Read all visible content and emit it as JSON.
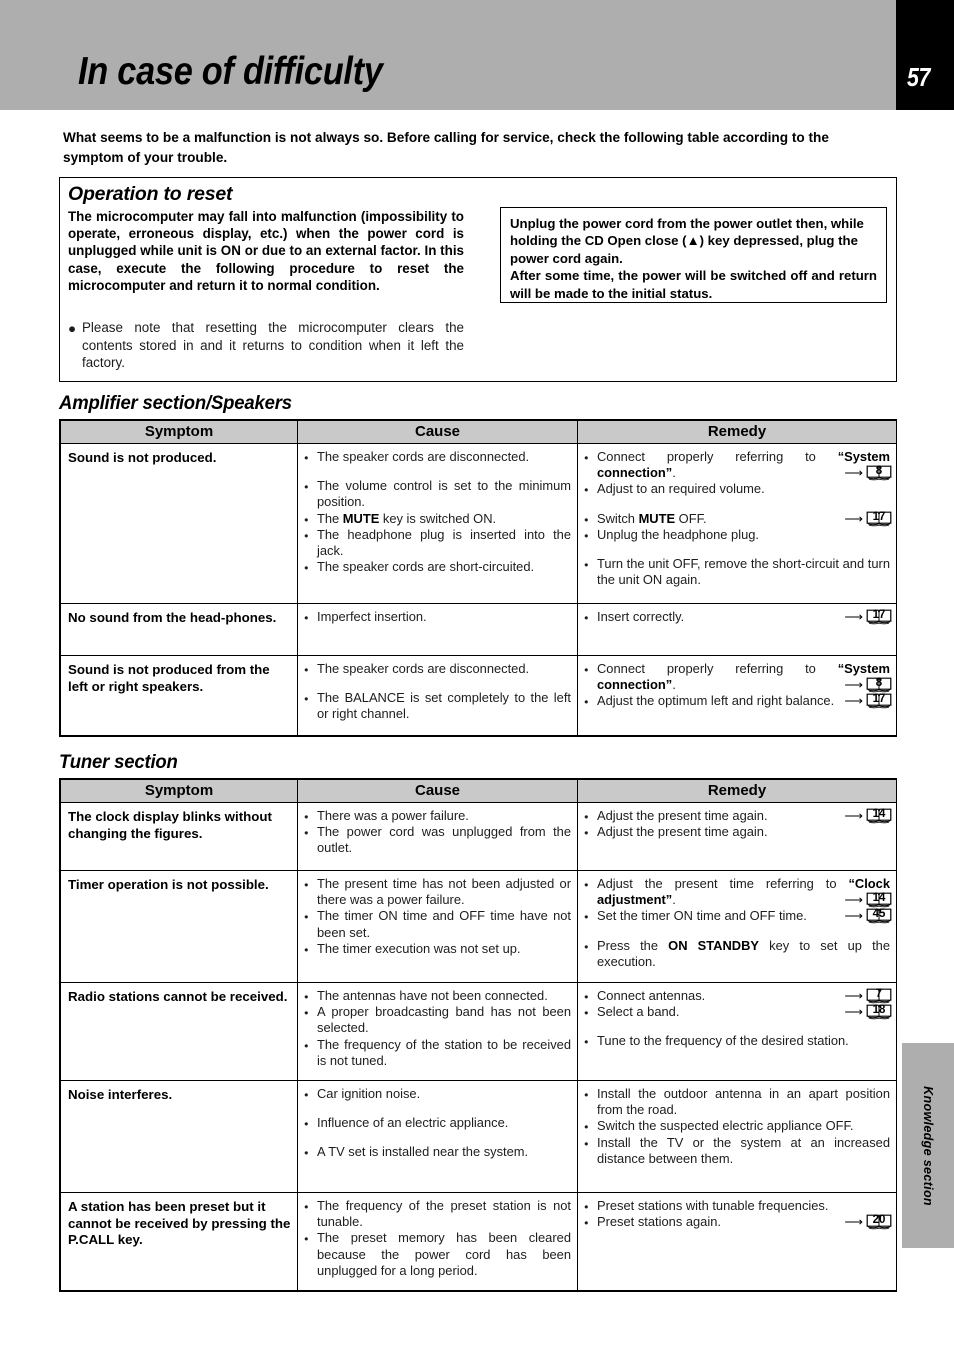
{
  "header": {
    "title": "In case of difficulty",
    "page_number": "57"
  },
  "intro": "What seems to be a malfunction is not always so.  Before calling for service, check the following table according to the symptom of your trouble.",
  "reset_box": {
    "title": "Operation to reset",
    "body": "The microcomputer may fall into malfunction (impossibility to operate, erroneous display, etc.) when the power cord is unplugged while unit is ON or due to an external factor. In this case, execute the following procedure to reset the microcomputer and return it to normal condition.",
    "bullet": "Please note that resetting the microcomputer clears the contents stored in and it returns to condition when it left the factory.",
    "inner_box": {
      "line1": "Unplug the power cord from the power outlet then, while holding the CD Open close (▲) key depressed, plug the  power cord again.",
      "line2": "After some time, the power will be switched off and return will be made to the initial status."
    }
  },
  "side_tab": {
    "label": "Knowledge section"
  },
  "tables": [
    {
      "heading": "Amplifier section/Speakers",
      "columns": [
        "Symptom",
        "Cause",
        "Remedy"
      ],
      "rows": [
        {
          "symptom": "Sound is not produced.",
          "causes": [
            {
              "text": "The speaker cords are disconnected."
            },
            {
              "text": "The volume control is set to the minimum position.",
              "gap": true
            },
            {
              "text": "The MUTE key is switched ON.",
              "bold": "MUTE"
            },
            {
              "text": "The headphone plug is inserted into the jack."
            },
            {
              "text": "The speaker cords are short-circuited."
            }
          ],
          "remedies": [
            {
              "text": "Connect properly referring to “System connection”.",
              "bold": "“System connection”",
              "ref": "8"
            },
            {
              "text": "Adjust to an required volume."
            },
            {
              "text": "Switch MUTE OFF.",
              "bold": "MUTE",
              "gap": true,
              "ref": "17"
            },
            {
              "text": "Unplug the headphone plug."
            },
            {
              "text": "Turn the unit OFF, remove the short-circuit  and turn the unit ON again.",
              "gap": true
            }
          ]
        },
        {
          "symptom": "No sound from the head-phones.",
          "causes": [
            {
              "text": "Imperfect insertion."
            }
          ],
          "remedies": [
            {
              "text": "Insert correctly.",
              "ref": "17"
            }
          ]
        },
        {
          "symptom": "Sound is not produced from the left or right speakers.",
          "causes": [
            {
              "text": "The speaker cords are disconnected."
            },
            {
              "text": "The BALANCE is set completely to the left or right channel.",
              "gap": true
            }
          ],
          "remedies": [
            {
              "text": "Connect properly referring to “System connection”.",
              "bold": "“System connection”",
              "ref": "8"
            },
            {
              "text": "Adjust the optimum left and right balance.",
              "ref": "17"
            }
          ]
        }
      ]
    },
    {
      "heading": "Tuner section",
      "columns": [
        "Symptom",
        "Cause",
        "Remedy"
      ],
      "rows": [
        {
          "symptom": "The clock display blinks without changing the figures.",
          "causes": [
            {
              "text": "There was a power failure."
            },
            {
              "text": "The power cord was unplugged from the outlet."
            }
          ],
          "remedies": [
            {
              "text": "Adjust the present time again.",
              "ref": "14"
            },
            {
              "text": "Adjust the present time again."
            }
          ]
        },
        {
          "symptom": "Timer operation is not possible.",
          "causes": [
            {
              "text": "The present time has not been adjusted or there was a power failure."
            },
            {
              "text": "The timer ON time and OFF time have not been set."
            },
            {
              "text": "The timer execution was not set up."
            }
          ],
          "remedies": [
            {
              "text": "Adjust the present time referring to “Clock adjustment”.",
              "bold": "“Clock adjustment”",
              "ref": "14"
            },
            {
              "text": "Set the timer ON time and OFF time.",
              "ref": "45"
            },
            {
              "text": "Press the ON STANDBY key to set up the execution.",
              "bold": "ON STANDBY",
              "gap": true
            }
          ]
        },
        {
          "symptom": "Radio stations cannot be received.",
          "causes": [
            {
              "text": "The antennas have not been connected."
            },
            {
              "text": "A proper broadcasting band has not been selected."
            },
            {
              "text": "The frequency of the station to be received is not tuned."
            }
          ],
          "remedies": [
            {
              "text": "Connect antennas.",
              "ref": "7"
            },
            {
              "text": "Select a band.",
              "ref": "18"
            },
            {
              "text": "Tune to the frequency of the desired station.",
              "gap": true
            }
          ]
        },
        {
          "symptom": "Noise interferes.",
          "causes": [
            {
              "text": "Car ignition noise."
            },
            {
              "text": "Influence of an electric appliance.",
              "gap": true
            },
            {
              "text": "A TV set is installed near the system.",
              "gap": true
            }
          ],
          "remedies": [
            {
              "text": "Install the outdoor antenna in an apart position from the road."
            },
            {
              "text": "Switch the suspected electric appliance OFF."
            },
            {
              "text": "Install the TV or the system at an increased distance between them."
            }
          ]
        },
        {
          "symptom": "A station has been preset but it cannot be received by pressing the P.CALL key.",
          "causes": [
            {
              "text": "The frequency of the preset station is not  tunable."
            },
            {
              "text": "The preset memory has been cleared because the power cord has been unplugged for a long period."
            }
          ],
          "remedies": [
            {
              "text": "Preset stations with tunable frequencies."
            },
            {
              "text": "Preset stations again.",
              "ref": "20"
            }
          ]
        }
      ]
    }
  ]
}
